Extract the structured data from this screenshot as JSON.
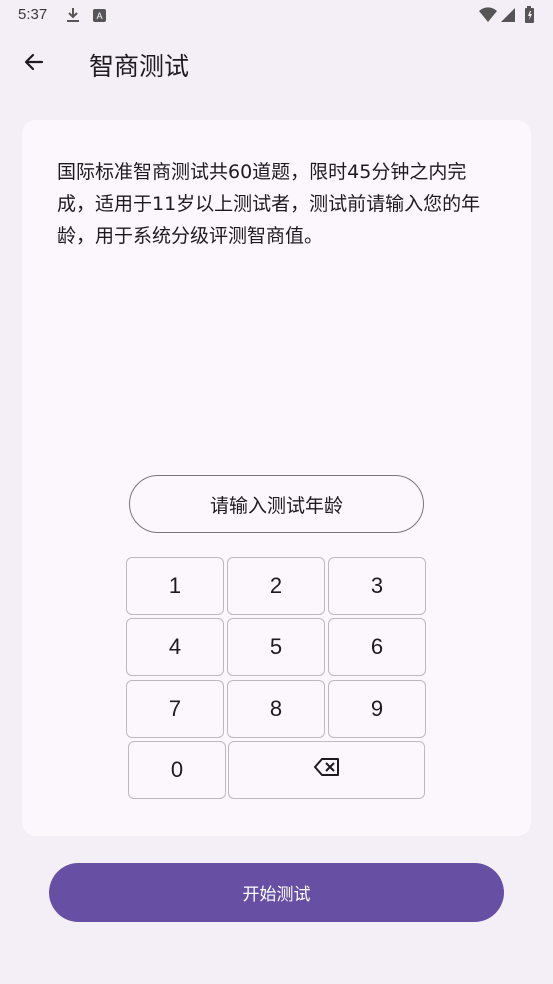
{
  "status_bar": {
    "time": "5:37",
    "icons": [
      "download-icon",
      "text-icon",
      "wifi-icon",
      "signal-icon",
      "battery-icon"
    ]
  },
  "app_bar": {
    "title": "智商测试",
    "back_icon": "arrow-left-icon"
  },
  "card": {
    "description": "国际标准智商测试共60道题，限时45分钟之内完成，适用于11岁以上测试者，测试前请输入您的年龄，用于系统分级评测智商值。",
    "age_input_placeholder": "请输入测试年龄"
  },
  "keypad": {
    "keys": [
      "1",
      "2",
      "3",
      "4",
      "5",
      "6",
      "7",
      "8",
      "9",
      "0"
    ],
    "backspace_icon": "backspace-icon"
  },
  "start_button": {
    "label": "开始测试"
  },
  "colors": {
    "background": "#f4eff7",
    "card": "#fcf7fd",
    "accent": "#6750a4"
  }
}
